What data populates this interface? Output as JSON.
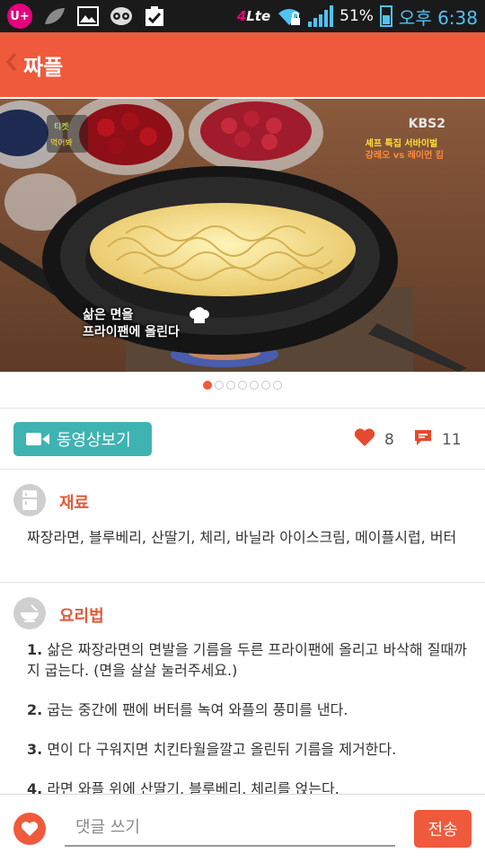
{
  "status_bar": {
    "carrier": "U+",
    "network": "4G LTE",
    "battery": "51%",
    "time": "오후 6:38",
    "icons": [
      "uplus-icon",
      "leaf-icon",
      "gallery-icon",
      "owl-icon",
      "checklist-icon",
      "wifi-icon",
      "signal-icon",
      "battery-icon"
    ]
  },
  "app_bar": {
    "back_icon": "chevron-left-icon",
    "title": "짜플"
  },
  "hero": {
    "caption_line1": "삶은 면을",
    "caption_line2": "프라이팬에 올린다",
    "broadcaster": "KBS2",
    "tag_line1": "셰프 특집 서바이벌",
    "tag_line2": "강레오 vs 레이먼 킴",
    "page_count": 7,
    "active_page": 1
  },
  "actions": {
    "video_button_label": "동영상보기",
    "likes_count": "8",
    "comments_count": "11"
  },
  "ingredients": {
    "title": "재료",
    "text": "짜장라면, 블루베리, 산딸기, 체리, 바닐라 아이스크림, 메이플시럽, 버터"
  },
  "recipe": {
    "title": "요리법",
    "steps": [
      {
        "num": "1.",
        "text": "삶은 짜장라면의 면발을 기름을 두른 프라이팬에 올리고 바삭해 질때까지 굽는다. (면을 살살 눌러주세요.)"
      },
      {
        "num": "2.",
        "text": "굽는 중간에 팬에 버터를 녹여 와플의 풍미를 낸다."
      },
      {
        "num": "3.",
        "text": "면이 다 구워지면 치킨타월을깔고 올린뒤 기름을 제거한다."
      },
      {
        "num": "4.",
        "text": "라면 와플 위에 산딸기, 블루베리, 체리를 얹는다."
      }
    ]
  },
  "bottom_bar": {
    "comment_placeholder": "댓글 쓰기",
    "send_label": "전송"
  },
  "colors": {
    "accent": "#ef5a3c",
    "teal": "#3fb3b1",
    "status_blue": "#4fc3f7"
  }
}
